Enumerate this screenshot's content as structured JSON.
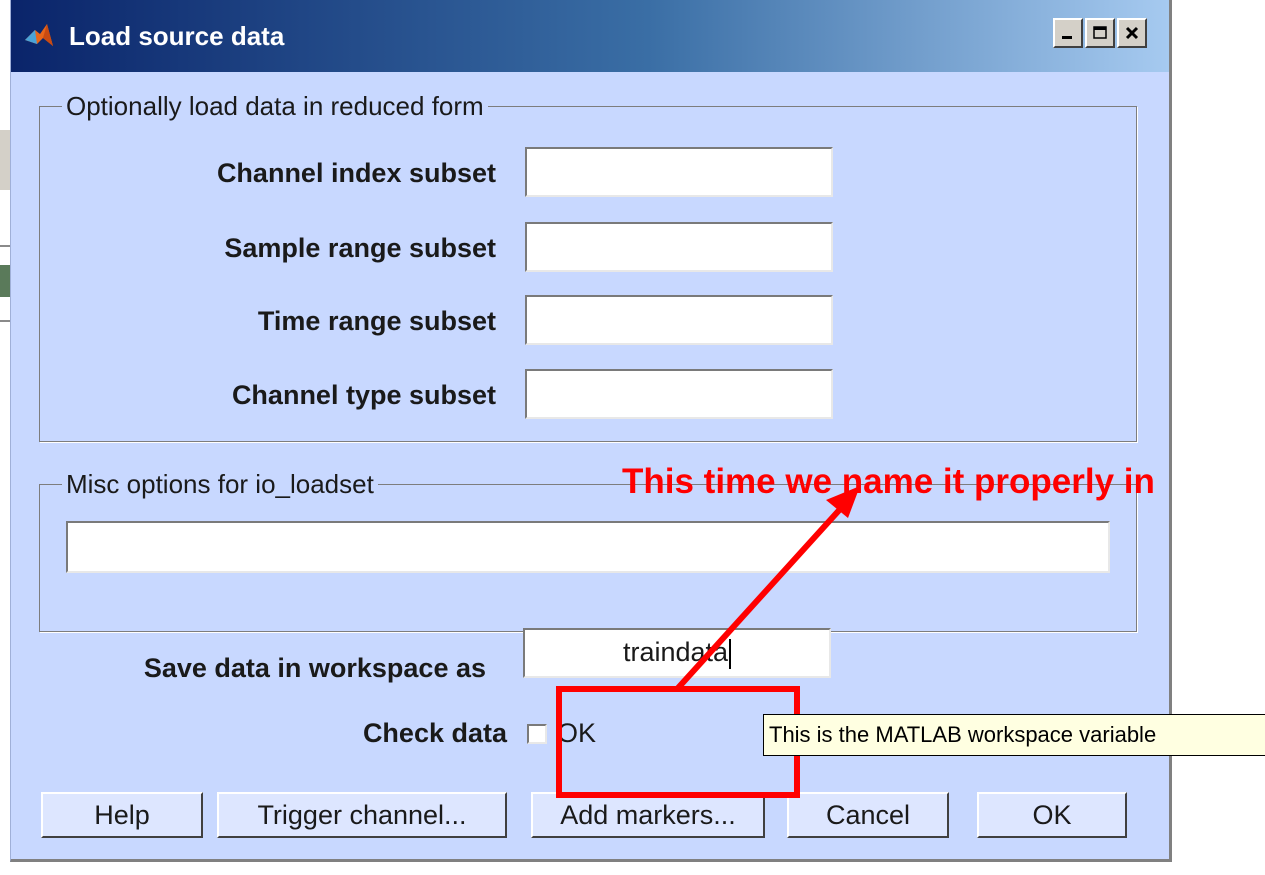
{
  "window": {
    "title": "Load source data",
    "controls": {
      "minimize": "minimize",
      "maximize": "maximize",
      "close": "close"
    }
  },
  "reduced_form_group": {
    "title": "Optionally load data in reduced form",
    "fields": [
      {
        "label": "Channel index subset",
        "value": ""
      },
      {
        "label": "Sample range subset",
        "value": ""
      },
      {
        "label": "Time range subset",
        "value": ""
      },
      {
        "label": "Channel type subset",
        "value": ""
      }
    ]
  },
  "misc_group": {
    "title": "Misc options for io_loadset",
    "value": ""
  },
  "save_as": {
    "label": "Save data in workspace as",
    "value": "traindata"
  },
  "check_data": {
    "label": "Check data",
    "checkbox_label": "OK",
    "checked": false
  },
  "buttons": {
    "help": "Help",
    "trigger_channel": "Trigger channel...",
    "add_markers": "Add markers...",
    "cancel": "Cancel",
    "ok": "OK"
  },
  "tooltip": {
    "text": "This is the MATLAB workspace variable"
  },
  "annotation": {
    "text": "This time we name it properly in",
    "color": "#ff0000"
  },
  "colors": {
    "dialog_background": "#c8d8ff",
    "titlebar_start": "#0a246a",
    "titlebar_end": "#a6caf0"
  },
  "icons": {
    "app": "matlab-icon",
    "minimize": "minimize-icon",
    "maximize": "maximize-icon",
    "close": "close-icon"
  }
}
